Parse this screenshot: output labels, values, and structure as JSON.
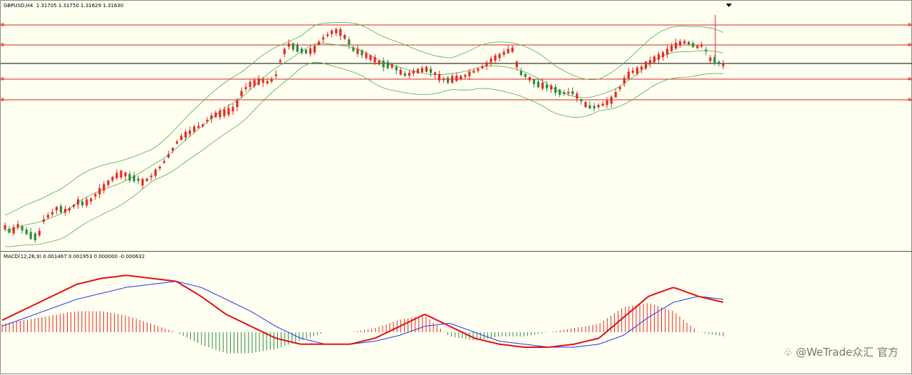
{
  "window": {
    "title": "GBPUSD,H4  1.31705 1.31750 1.31629 1.31630",
    "symbol": "GBPUSD",
    "timeframe": "H4",
    "open": "1.31705",
    "high": "1.31750",
    "low": "1.31629",
    "close": "1.31630"
  },
  "indicator": {
    "label": "MACD(12,26,9) 0.001467 0.001953 0.000000 -0.000632",
    "name": "MACD",
    "params": "12,26,9",
    "values": [
      "0.001467",
      "0.001953",
      "0.000000",
      "-0.000632"
    ]
  },
  "watermark": {
    "text": "@WeTrade众汇 官方",
    "icon": "swirl-logo-icon"
  },
  "colors": {
    "background": "#fffff2",
    "bull_candle": "#e8281e",
    "bear_candle": "#2e8b3a",
    "bollinger": "#4caf50",
    "horizontal_levels": "#e02020",
    "current_price_line": "#000000",
    "macd_line": "#e01010",
    "signal_line": "#2233ee",
    "hist_positive": "#e8281e",
    "hist_negative": "#2e8b3a"
  },
  "chart_data": [
    {
      "type": "candlestick",
      "series": [
        {
          "name": "GBPUSD,H4",
          "trend_y": [
            318,
            325,
            315,
            322,
            330,
            332,
            305,
            300,
            290,
            295,
            292,
            282,
            285,
            280,
            270,
            262,
            252,
            245,
            242,
            248,
            250,
            255,
            248,
            240,
            228,
            215,
            200,
            190,
            185,
            178,
            175,
            165,
            160,
            158,
            155,
            150,
            128,
            118,
            115,
            112,
            115,
            108,
            78,
            62,
            65,
            70,
            72,
            68,
            55,
            48,
            42,
            45,
            55,
            70,
            72,
            78,
            82,
            88,
            90,
            92,
            100,
            105,
            100,
            98,
            96,
            100,
            108,
            112,
            110,
            108,
            105,
            100,
            96,
            90,
            82,
            78,
            72,
            68,
            100,
            105,
            112,
            118,
            120,
            122,
            128,
            130,
            128,
            135,
            145,
            150,
            148,
            145,
            140,
            128,
            112,
            100,
            98,
            92,
            85,
            80,
            75,
            68,
            62,
            58,
            60,
            65,
            62,
            82,
            85,
            90
          ]
        }
      ]
    },
    {
      "type": "line",
      "series": [
        {
          "name": "MACD(12,26,9)",
          "values": [
            0.0004,
            0.0008,
            0.0012,
            0.0016,
            0.0018,
            0.0019,
            0.0018,
            0.0017,
            0.0012,
            0.0006,
            0.0002,
            -0.0002,
            -0.0004,
            -0.0004,
            -0.0004,
            -0.0002,
            0.0002,
            0.0006,
            0.0002,
            -0.0002,
            -0.0004,
            -0.0005,
            -0.0005,
            -0.0004,
            -0.0002,
            0.0005,
            0.0012,
            0.0015,
            0.0012,
            0.001
          ]
        },
        {
          "name": "Signal",
          "values": [
            0.0002,
            0.0005,
            0.0008,
            0.0011,
            0.0013,
            0.0015,
            0.0016,
            0.0017,
            0.0015,
            0.0011,
            0.0007,
            0.0002,
            -0.0002,
            -0.0004,
            -0.0004,
            -0.0003,
            -0.0001,
            0.0002,
            0.0003,
            0.0,
            -0.0003,
            -0.0004,
            -0.0005,
            -0.0005,
            -0.0004,
            -0.0001,
            0.0005,
            0.001,
            0.0012,
            0.0011
          ]
        }
      ]
    }
  ]
}
